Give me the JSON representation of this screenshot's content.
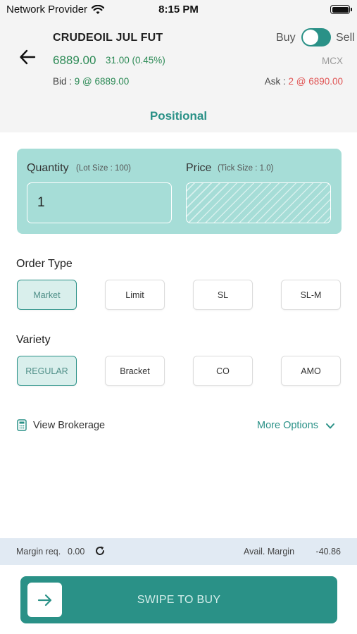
{
  "status_bar": {
    "carrier": "Network Provider",
    "time": "8:15 PM"
  },
  "instrument": {
    "name": "CRUDEOIL JUL FUT",
    "ltp": "6889.00",
    "change": "31.00 (0.45%)",
    "exchange": "MCX",
    "bid_label": "Bid : ",
    "bid_value": "9 @ 6889.00",
    "ask_label": "Ask : ",
    "ask_value": "2 @ 6890.00"
  },
  "side_toggle": {
    "buy_label": "Buy",
    "sell_label": "Sell",
    "selected": "Buy"
  },
  "product_tab": "Positional",
  "quantity": {
    "label": "Quantity",
    "hint": "(Lot Size : 100)",
    "value": "1"
  },
  "price": {
    "label": "Price",
    "hint": "(Tick Size : 1.0)"
  },
  "order_type": {
    "title": "Order Type",
    "options": [
      "Market",
      "Limit",
      "SL",
      "SL-M"
    ],
    "selected": "Market"
  },
  "variety": {
    "title": "Variety",
    "options": [
      "REGULAR",
      "Bracket",
      "CO",
      "AMO"
    ],
    "selected": "REGULAR"
  },
  "links": {
    "view_brokerage": "View Brokerage",
    "more_options": "More Options"
  },
  "margin": {
    "req_label": "Margin req.",
    "req_value": "0.00",
    "avail_label": "Avail. Margin",
    "avail_value": "-40.86"
  },
  "action": {
    "swipe_label": "SWIPE TO BUY"
  },
  "colors": {
    "accent": "#2a9187",
    "card": "#a6ddd7",
    "positive": "#2e8b57",
    "negative": "#e05555"
  }
}
